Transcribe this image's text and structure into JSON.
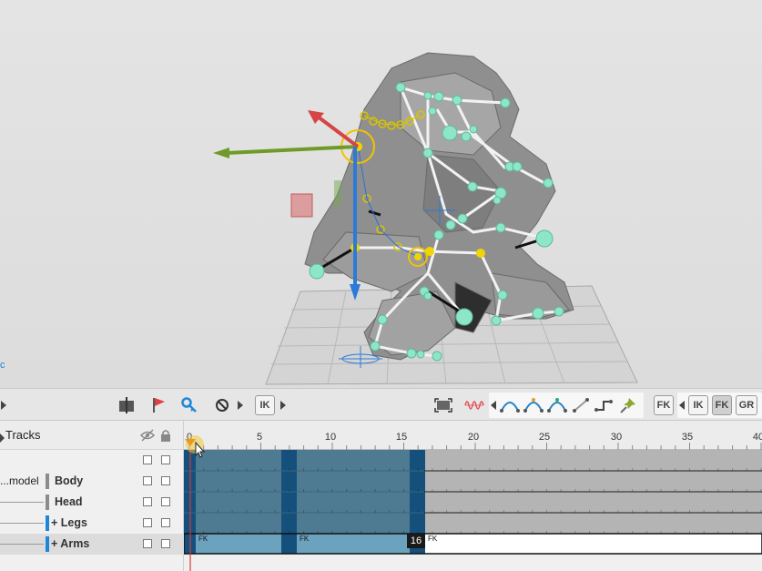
{
  "viewport": {
    "corner_label": "c"
  },
  "toolbar": {
    "ik_label": "IK",
    "fk_label": "FK",
    "ik2_label": "IK",
    "fk2_label": "FK",
    "gr_label": "GR"
  },
  "tracks": {
    "title": "Tracks",
    "rows": [
      {
        "model": "",
        "name": "",
        "color": ""
      },
      {
        "model": "...model",
        "name": "Body",
        "color": "#8c8c8c"
      },
      {
        "model": "",
        "name": "Head",
        "color": "#8c8c8c"
      },
      {
        "model": "",
        "name": "+ Legs",
        "color": "#1e88d8"
      },
      {
        "model": "",
        "name": "+ Arms",
        "color": "#1e88d8"
      }
    ]
  },
  "timeline": {
    "ruler_ticks": [
      "0",
      "5",
      "10",
      "15",
      "20",
      "25",
      "30",
      "35",
      "40"
    ],
    "clip_labels": [
      "FK",
      "FK",
      "FK"
    ],
    "frame_badge": "16"
  },
  "colors": {
    "timeline_active": "#4e7a92",
    "timeline_key": "#15507d",
    "timeline_inactive": "#b4b4b4",
    "arms_clip": "#6ba3bf",
    "joint": "#8ee6c8",
    "selected_joint": "#f2d400"
  }
}
